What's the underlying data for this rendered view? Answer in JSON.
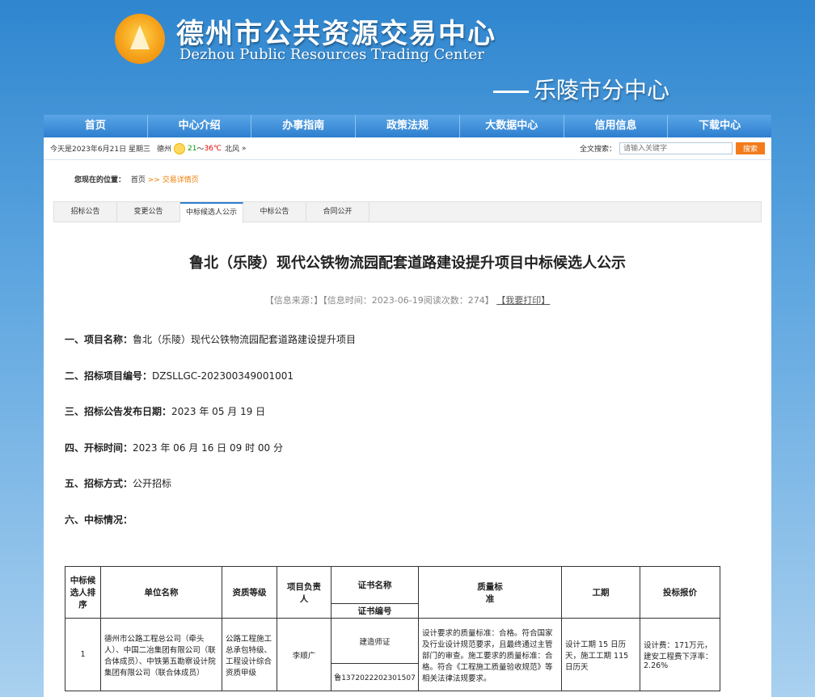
{
  "header": {
    "title_cn": "德州市公共资源交易中心",
    "title_en": "Dezhou Public Resources Trading Center",
    "sub_center": "乐陵市分中心"
  },
  "nav": [
    "首页",
    "中心介绍",
    "办事指南",
    "政策法规",
    "大数据中心",
    "信用信息",
    "下载中心"
  ],
  "infobar": {
    "date": "今天是2023年6月21日 星期三",
    "city": "德州",
    "temp_low": "21",
    "temp_sep": "～",
    "temp_high": "36℃",
    "wind": "北风",
    "chevron": "»",
    "search_label": "全文搜索：",
    "search_placeholder": "请输入关键字",
    "search_button": "搜索"
  },
  "breadcrumb": {
    "label": "您现在的位置：",
    "home": "首页",
    "sep": ">>",
    "current": "交易详情页"
  },
  "tabs": [
    "招标公告",
    "变更公告",
    "中标候选人公示",
    "中标公告",
    "合同公开"
  ],
  "active_tab_index": 2,
  "article": {
    "title": "鲁北（乐陵）现代公铁物流园配套道路建设提升项目中标候选人公示",
    "meta_source": "【信息来源：】【信息时间：2023-06-19阅读次数：274】",
    "meta_print": "【我要打印】"
  },
  "items": [
    {
      "label": "一、项目名称：",
      "value": "鲁北（乐陵）现代公铁物流园配套道路建设提升项目"
    },
    {
      "label": "二、招标项目编号：",
      "value": "DZSLLGC-202300349001001"
    },
    {
      "label": "三、招标公告发布日期：",
      "value": "2023 年 05 月 19 日"
    },
    {
      "label": "四、开标时间：",
      "value": "2023 年 06 月 16 日 09 时 00 分"
    },
    {
      "label": "五、招标方式：",
      "value": "公开招标"
    },
    {
      "label": "六、中标情况：",
      "value": ""
    }
  ],
  "table": {
    "headers": {
      "rank": "中标候选人排序",
      "company": "单位名称",
      "qualification": "资质等级",
      "manager": "项目负责人",
      "cert_name": "证书名称",
      "cert_no": "证书编号",
      "quality": "质量标准",
      "period": "工期",
      "price": "投标报价"
    },
    "rows": [
      {
        "rank": "1",
        "company": "德州市公路工程总公司（牵头人）、中国二冶集团有限公司（联合体成员）、中铁第五勘察设计院集团有限公司（联合体成员）",
        "qualification": "公路工程施工总承包特级、工程设计综合资质甲级",
        "manager": "李顺广",
        "cert_name": "建造师证",
        "cert_no": "鲁1372022202301507",
        "quality": "设计要求的质量标准：合格。符合国家及行业设计规范要求，且最终通过主管部门的审查。施工要求的质量标准：合格。符合《工程施工质量验收规范》等相关法律法规要求。",
        "period": "设计工期 15 日历天，施工工期 115 日历天",
        "price": "设计费：171万元，建安工程费下浮率：2.26%"
      }
    ]
  }
}
